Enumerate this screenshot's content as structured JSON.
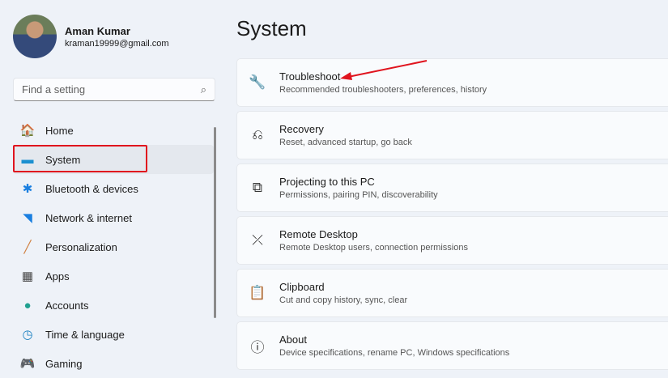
{
  "user": {
    "name": "Aman Kumar",
    "email": "kraman19999@gmail.com"
  },
  "search": {
    "placeholder": "Find a setting"
  },
  "nav": [
    {
      "label": "Home",
      "icon": "home-icon",
      "glyph": "🏠",
      "color": "#e07a3a"
    },
    {
      "label": "System",
      "icon": "system-icon",
      "glyph": "▬",
      "color": "#1a8fd0"
    },
    {
      "label": "Bluetooth & devices",
      "icon": "bluetooth-icon",
      "glyph": "✱",
      "color": "#1a7fe0"
    },
    {
      "label": "Network & internet",
      "icon": "wifi-icon",
      "glyph": "◥",
      "color": "#1a7fe0"
    },
    {
      "label": "Personalization",
      "icon": "brush-icon",
      "glyph": "╱",
      "color": "#d08040"
    },
    {
      "label": "Apps",
      "icon": "apps-icon",
      "glyph": "▦",
      "color": "#444"
    },
    {
      "label": "Accounts",
      "icon": "accounts-icon",
      "glyph": "●",
      "color": "#20a090"
    },
    {
      "label": "Time & language",
      "icon": "globe-clock-icon",
      "glyph": "◷",
      "color": "#1a80c0"
    },
    {
      "label": "Gaming",
      "icon": "gamepad-icon",
      "glyph": "🎮",
      "color": "#8090a0"
    }
  ],
  "page_title": "System",
  "cards": [
    {
      "title": "Troubleshoot",
      "subtitle": "Recommended troubleshooters, preferences, history",
      "icon": "wrench-icon",
      "glyph": "🔧"
    },
    {
      "title": "Recovery",
      "subtitle": "Reset, advanced startup, go back",
      "icon": "recovery-icon",
      "glyph": "⎌"
    },
    {
      "title": "Projecting to this PC",
      "subtitle": "Permissions, pairing PIN, discoverability",
      "icon": "projecting-icon",
      "glyph": "⧉"
    },
    {
      "title": "Remote Desktop",
      "subtitle": "Remote Desktop users, connection permissions",
      "icon": "remote-desktop-icon",
      "glyph": "⤫"
    },
    {
      "title": "Clipboard",
      "subtitle": "Cut and copy history, sync, clear",
      "icon": "clipboard-icon",
      "glyph": "📋"
    },
    {
      "title": "About",
      "subtitle": "Device specifications, rename PC, Windows specifications",
      "icon": "info-icon",
      "glyph": "ⓘ"
    }
  ],
  "annotation_color": "#e0141e"
}
